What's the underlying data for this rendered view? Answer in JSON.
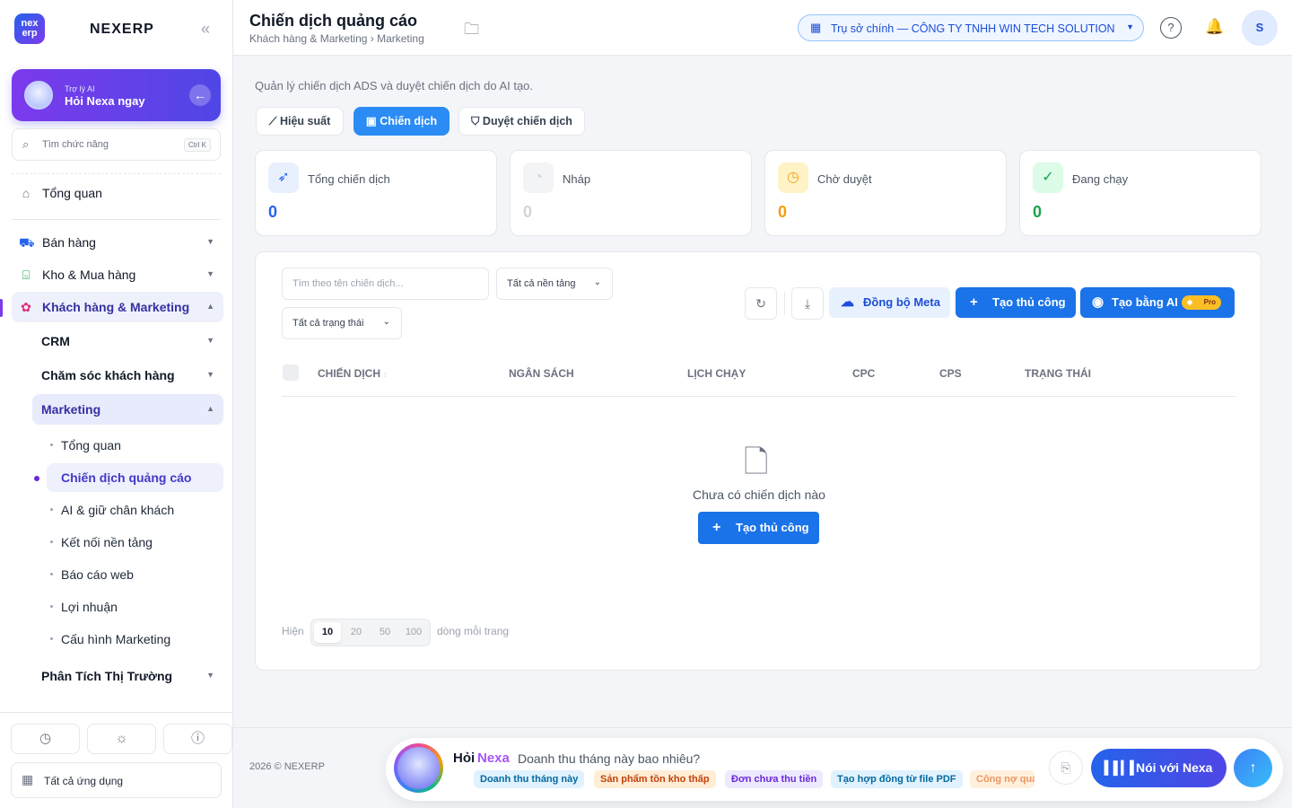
{
  "app": {
    "brand": "NEXERP",
    "logo_text": "nex erp",
    "collapse_icon": "chevrons-left-icon"
  },
  "ai_card": {
    "small": "Trợ lý AI",
    "big": "Hỏi Nexa ngay"
  },
  "search": {
    "placeholder": "Tìm chức năng",
    "shortcut": "Ctrl K"
  },
  "sidebar": {
    "overview": "Tổng quan",
    "groups": [
      {
        "label": "Bán hàng",
        "icon": "cart-icon"
      },
      {
        "label": "Kho & Mua hàng",
        "icon": "bag-icon"
      },
      {
        "label": "Khách hàng & Marketing",
        "icon": "users-icon"
      }
    ],
    "subgroups": [
      "CRM",
      "Chăm sóc khách hàng",
      "Marketing",
      "Phân Tích Thị Trường"
    ],
    "leaves": [
      "Tổng quan",
      "Chiến dịch quảng cáo",
      "AI & giữ chân khách",
      "Kết nối nền tảng",
      "Báo cáo web",
      "Lợi nhuận",
      "Cấu hình Marketing"
    ],
    "all_apps": "Tất cả ứng dụng"
  },
  "header": {
    "title": "Chiến dịch quảng cáo",
    "breadcrumb": "Khách hàng & Marketing › Marketing",
    "branch": "Trụ sở chính — CÔNG TY TNHH WIN TECH SOLUTION",
    "avatar": "S"
  },
  "page": {
    "description": "Quản lý chiến dịch ADS và duyệt chiến dịch do AI tạo.",
    "tabs": [
      "Hiệu suất",
      "Chiến dịch",
      "Duyệt chiến dịch"
    ],
    "stats": [
      {
        "label": "Tổng chiến dịch",
        "value": "0",
        "color": "#2563eb",
        "icon": "rocket-icon"
      },
      {
        "label": "Nháp",
        "value": "0",
        "color": "#d1d5db",
        "icon": "draft-icon"
      },
      {
        "label": "Chờ duyệt",
        "value": "0",
        "color": "#f59e0b",
        "icon": "clock-icon"
      },
      {
        "label": "Đang chạy",
        "value": "0",
        "color": "#16a34a",
        "icon": "check-circle-icon"
      }
    ]
  },
  "filters": {
    "search_placeholder": "Tìm theo tên chiến dịch...",
    "platform": "Tất cả nền tảng",
    "status": "Tất cả trạng thái"
  },
  "actions": {
    "sync_meta": "Đồng bộ Meta",
    "create_manual": "Tạo thủ công",
    "create_ai": "Tạo bằng AI",
    "pro_badge": "Pro"
  },
  "table": {
    "columns": [
      "CHIẾN DỊCH",
      "NGÂN SÁCH",
      "LỊCH CHẠY",
      "CPC",
      "CPS",
      "TRẠNG THÁI"
    ],
    "empty_text": "Chưa có chiến dịch nào",
    "empty_button": "Tạo thủ công"
  },
  "pagination": {
    "prefix": "Hiện",
    "sizes": [
      "10",
      "20",
      "50",
      "100"
    ],
    "selected": "10",
    "suffix": "dòng mỗi trang"
  },
  "footer": {
    "copyright": "2026 © NEXERP"
  },
  "nexa": {
    "ask": "Hỏi",
    "brand": "Nexa",
    "question": "Doanh thu tháng này bao nhiêu?",
    "chips": [
      "Doanh thu tháng này",
      "Sản phẩm tồn kho thấp",
      "Đơn chưa thu tiền",
      "Tạo hợp đồng từ file PDF",
      "Công nợ quá hạn"
    ],
    "talk": "Nói với Nexa"
  }
}
